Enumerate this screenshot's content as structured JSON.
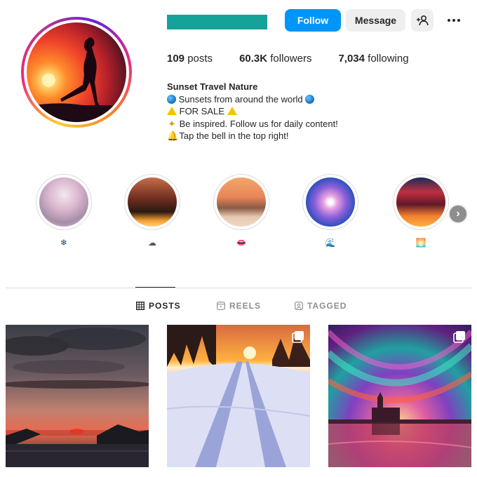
{
  "profile": {
    "follow_label": "Follow",
    "message_label": "Message",
    "add_user_icon": "add-user-icon",
    "more_icon": "more-options-icon",
    "username_color": "#14a39a"
  },
  "stats": {
    "posts_count": "109",
    "posts_label": "posts",
    "followers_count": "60.3K",
    "followers_label": "followers",
    "following_count": "7,034",
    "following_label": "following"
  },
  "bio": {
    "name": "Sunset Travel Nature",
    "line1": "Sunsets from around the world",
    "line2": "FOR SALE",
    "line3": "Be inspired. Follow us for daily content!",
    "line4": "Tap the bell in the top right!"
  },
  "highlights": [
    {
      "label_icon": "❄"
    },
    {
      "label_icon": "☁"
    },
    {
      "label_icon": "👄"
    },
    {
      "label_icon": "🌊"
    },
    {
      "label_icon": "🌅"
    }
  ],
  "tabs": {
    "posts": "POSTS",
    "reels": "REELS",
    "tagged": "TAGGED"
  },
  "colors": {
    "accent": "#0095f6",
    "secondary_button": "#efefef",
    "text": "#262626",
    "muted": "#8e8e8e"
  }
}
